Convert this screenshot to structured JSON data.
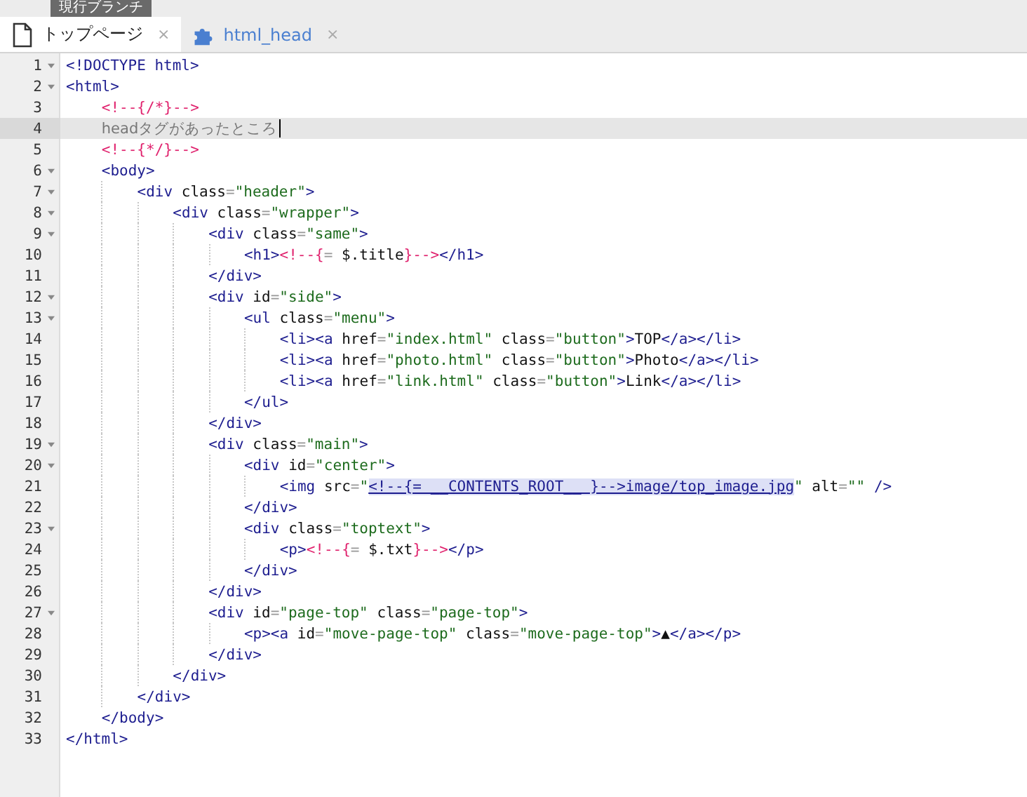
{
  "branch_label": "現行ブランチ",
  "tabs": [
    {
      "label": "トップページ",
      "selected": true,
      "close": "×"
    },
    {
      "label": "html_head",
      "selected": false,
      "close": "×"
    }
  ],
  "editor": {
    "lines": [
      {
        "number": "1",
        "foldable": true,
        "current": false,
        "tokens": [
          {
            "kind": "tag",
            "text": "<!DOCTYPE html>"
          }
        ]
      },
      {
        "number": "2",
        "foldable": true,
        "current": false,
        "tokens": [
          {
            "kind": "tag",
            "text": "<html>"
          }
        ],
        "children": [
          {
            "number": "3",
            "foldable": false,
            "current": false,
            "tokens": [
              {
                "kind": "tpl",
                "text": "<!--{/*}-->"
              }
            ]
          },
          {
            "number": "4",
            "foldable": false,
            "current": true,
            "tokens": [
              {
                "kind": "text",
                "text": "headタグがあったところ"
              }
            ]
          },
          {
            "number": "5",
            "foldable": false,
            "current": false,
            "tokens": [
              {
                "kind": "tpl",
                "text": "<!--{*/}-->"
              }
            ]
          },
          {
            "number": "6",
            "foldable": true,
            "current": false,
            "tokens": [
              {
                "kind": "tag",
                "text": "<body>"
              }
            ],
            "children": [
              {
                "number": "7",
                "foldable": true,
                "current": false,
                "tokens": [
                  {
                    "kind": "tag",
                    "text": "<div "
                  },
                  {
                    "kind": "attr",
                    "text": "class"
                  },
                  {
                    "kind": "op",
                    "text": "="
                  },
                  {
                    "kind": "str",
                    "text": "\"header\""
                  },
                  {
                    "kind": "tag",
                    "text": ">"
                  }
                ],
                "children": [
                  {
                    "number": "8",
                    "foldable": true,
                    "current": false,
                    "tokens": [
                      {
                        "kind": "tag",
                        "text": "<div "
                      },
                      {
                        "kind": "attr",
                        "text": "class"
                      },
                      {
                        "kind": "op",
                        "text": "="
                      },
                      {
                        "kind": "str",
                        "text": "\"wrapper\""
                      },
                      {
                        "kind": "tag",
                        "text": ">"
                      }
                    ],
                    "children": [
                      {
                        "number": "9",
                        "foldable": true,
                        "current": false,
                        "tokens": [
                          {
                            "kind": "tag",
                            "text": "<div "
                          },
                          {
                            "kind": "attr",
                            "text": "class"
                          },
                          {
                            "kind": "op",
                            "text": "="
                          },
                          {
                            "kind": "str",
                            "text": "\"same\""
                          },
                          {
                            "kind": "tag",
                            "text": ">"
                          }
                        ],
                        "children": [
                          {
                            "number": "10",
                            "foldable": false,
                            "current": false,
                            "tokens": [
                              {
                                "kind": "tag",
                                "text": "<h1>"
                              },
                              {
                                "kind": "tpl",
                                "text": "<!--{"
                              },
                              {
                                "kind": "op",
                                "text": "="
                              },
                              {
                                "kind": "attr",
                                "text": " $.title"
                              },
                              {
                                "kind": "tpl",
                                "text": "}-->"
                              },
                              {
                                "kind": "tag",
                                "text": "</h1>"
                              }
                            ]
                          }
                        ]
                      },
                      {
                        "number": "11",
                        "foldable": false,
                        "current": false,
                        "tokens": [
                          {
                            "kind": "tag",
                            "text": "</div>"
                          }
                        ]
                      },
                      {
                        "number": "12",
                        "foldable": true,
                        "current": false,
                        "tokens": [
                          {
                            "kind": "tag",
                            "text": "<div "
                          },
                          {
                            "kind": "attr",
                            "text": "id"
                          },
                          {
                            "kind": "op",
                            "text": "="
                          },
                          {
                            "kind": "str",
                            "text": "\"side\""
                          },
                          {
                            "kind": "tag",
                            "text": ">"
                          }
                        ],
                        "children": [
                          {
                            "number": "13",
                            "foldable": true,
                            "current": false,
                            "tokens": [
                              {
                                "kind": "tag",
                                "text": "<ul "
                              },
                              {
                                "kind": "attr",
                                "text": "class"
                              },
                              {
                                "kind": "op",
                                "text": "="
                              },
                              {
                                "kind": "str",
                                "text": "\"menu\""
                              },
                              {
                                "kind": "tag",
                                "text": ">"
                              }
                            ],
                            "children": [
                              {
                                "number": "14",
                                "foldable": false,
                                "current": false,
                                "tokens": [
                                  {
                                    "kind": "tag",
                                    "text": "<li><a "
                                  },
                                  {
                                    "kind": "attr",
                                    "text": "href"
                                  },
                                  {
                                    "kind": "op",
                                    "text": "="
                                  },
                                  {
                                    "kind": "str",
                                    "text": "\"index.html\""
                                  },
                                  {
                                    "kind": "attr",
                                    "text": " class"
                                  },
                                  {
                                    "kind": "op",
                                    "text": "="
                                  },
                                  {
                                    "kind": "str",
                                    "text": "\"button\""
                                  },
                                  {
                                    "kind": "tag",
                                    "text": ">"
                                  },
                                  {
                                    "kind": "attr",
                                    "text": "TOP"
                                  },
                                  {
                                    "kind": "tag",
                                    "text": "</a></li>"
                                  }
                                ]
                              },
                              {
                                "number": "15",
                                "foldable": false,
                                "current": false,
                                "tokens": [
                                  {
                                    "kind": "tag",
                                    "text": "<li><a "
                                  },
                                  {
                                    "kind": "attr",
                                    "text": "href"
                                  },
                                  {
                                    "kind": "op",
                                    "text": "="
                                  },
                                  {
                                    "kind": "str",
                                    "text": "\"photo.html\""
                                  },
                                  {
                                    "kind": "attr",
                                    "text": " class"
                                  },
                                  {
                                    "kind": "op",
                                    "text": "="
                                  },
                                  {
                                    "kind": "str",
                                    "text": "\"button\""
                                  },
                                  {
                                    "kind": "tag",
                                    "text": ">"
                                  },
                                  {
                                    "kind": "attr",
                                    "text": "Photo"
                                  },
                                  {
                                    "kind": "tag",
                                    "text": "</a></li>"
                                  }
                                ]
                              },
                              {
                                "number": "16",
                                "foldable": false,
                                "current": false,
                                "tokens": [
                                  {
                                    "kind": "tag",
                                    "text": "<li><a "
                                  },
                                  {
                                    "kind": "attr",
                                    "text": "href"
                                  },
                                  {
                                    "kind": "op",
                                    "text": "="
                                  },
                                  {
                                    "kind": "str",
                                    "text": "\"link.html\""
                                  },
                                  {
                                    "kind": "attr",
                                    "text": " class"
                                  },
                                  {
                                    "kind": "op",
                                    "text": "="
                                  },
                                  {
                                    "kind": "str",
                                    "text": "\"button\""
                                  },
                                  {
                                    "kind": "tag",
                                    "text": ">"
                                  },
                                  {
                                    "kind": "attr",
                                    "text": "Link"
                                  },
                                  {
                                    "kind": "tag",
                                    "text": "</a></li>"
                                  }
                                ]
                              }
                            ]
                          },
                          {
                            "number": "17",
                            "foldable": false,
                            "current": false,
                            "tokens": [
                              {
                                "kind": "tag",
                                "text": "</ul>"
                              }
                            ]
                          }
                        ]
                      },
                      {
                        "number": "18",
                        "foldable": false,
                        "current": false,
                        "tokens": [
                          {
                            "kind": "tag",
                            "text": "</div>"
                          }
                        ]
                      },
                      {
                        "number": "19",
                        "foldable": true,
                        "current": false,
                        "tokens": [
                          {
                            "kind": "tag",
                            "text": "<div "
                          },
                          {
                            "kind": "attr",
                            "text": "class"
                          },
                          {
                            "kind": "op",
                            "text": "="
                          },
                          {
                            "kind": "str",
                            "text": "\"main\""
                          },
                          {
                            "kind": "tag",
                            "text": ">"
                          }
                        ],
                        "children": [
                          {
                            "number": "20",
                            "foldable": true,
                            "current": false,
                            "tokens": [
                              {
                                "kind": "tag",
                                "text": "<div "
                              },
                              {
                                "kind": "attr",
                                "text": "id"
                              },
                              {
                                "kind": "op",
                                "text": "="
                              },
                              {
                                "kind": "str",
                                "text": "\"center\""
                              },
                              {
                                "kind": "tag",
                                "text": ">"
                              }
                            ],
                            "children": [
                              {
                                "number": "21",
                                "foldable": false,
                                "current": false,
                                "tokens": [
                                  {
                                    "kind": "tag",
                                    "text": "<img "
                                  },
                                  {
                                    "kind": "attr",
                                    "text": "src"
                                  },
                                  {
                                    "kind": "op",
                                    "text": "="
                                  },
                                  {
                                    "kind": "str",
                                    "text": "\""
                                  },
                                  {
                                    "kind": "link",
                                    "text": "<!--{= __CONTENTS_ROOT__ }-->image/top_image.jpg"
                                  },
                                  {
                                    "kind": "str",
                                    "text": "\""
                                  },
                                  {
                                    "kind": "attr",
                                    "text": " alt"
                                  },
                                  {
                                    "kind": "op",
                                    "text": "="
                                  },
                                  {
                                    "kind": "str",
                                    "text": "\"\""
                                  },
                                  {
                                    "kind": "tag",
                                    "text": " />"
                                  }
                                ]
                              }
                            ]
                          },
                          {
                            "number": "22",
                            "foldable": false,
                            "current": false,
                            "tokens": [
                              {
                                "kind": "tag",
                                "text": "</div>"
                              }
                            ]
                          },
                          {
                            "number": "23",
                            "foldable": true,
                            "current": false,
                            "tokens": [
                              {
                                "kind": "tag",
                                "text": "<div "
                              },
                              {
                                "kind": "attr",
                                "text": "class"
                              },
                              {
                                "kind": "op",
                                "text": "="
                              },
                              {
                                "kind": "str",
                                "text": "\"toptext\""
                              },
                              {
                                "kind": "tag",
                                "text": ">"
                              }
                            ],
                            "children": [
                              {
                                "number": "24",
                                "foldable": false,
                                "current": false,
                                "tokens": [
                                  {
                                    "kind": "tag",
                                    "text": "<p>"
                                  },
                                  {
                                    "kind": "tpl",
                                    "text": "<!--{"
                                  },
                                  {
                                    "kind": "op",
                                    "text": "="
                                  },
                                  {
                                    "kind": "attr",
                                    "text": " $.txt"
                                  },
                                  {
                                    "kind": "tpl",
                                    "text": "}-->"
                                  },
                                  {
                                    "kind": "tag",
                                    "text": "</p>"
                                  }
                                ]
                              }
                            ]
                          },
                          {
                            "number": "25",
                            "foldable": false,
                            "current": false,
                            "tokens": [
                              {
                                "kind": "tag",
                                "text": "</div>"
                              }
                            ]
                          }
                        ]
                      },
                      {
                        "number": "26",
                        "foldable": false,
                        "current": false,
                        "tokens": [
                          {
                            "kind": "tag",
                            "text": "</div>"
                          }
                        ]
                      },
                      {
                        "number": "27",
                        "foldable": true,
                        "current": false,
                        "tokens": [
                          {
                            "kind": "tag",
                            "text": "<div "
                          },
                          {
                            "kind": "attr",
                            "text": "id"
                          },
                          {
                            "kind": "op",
                            "text": "="
                          },
                          {
                            "kind": "str",
                            "text": "\"page-top\""
                          },
                          {
                            "kind": "attr",
                            "text": " class"
                          },
                          {
                            "kind": "op",
                            "text": "="
                          },
                          {
                            "kind": "str",
                            "text": "\"page-top\""
                          },
                          {
                            "kind": "tag",
                            "text": ">"
                          }
                        ],
                        "children": [
                          {
                            "number": "28",
                            "foldable": false,
                            "current": false,
                            "tokens": [
                              {
                                "kind": "tag",
                                "text": "<p><a "
                              },
                              {
                                "kind": "attr",
                                "text": "id"
                              },
                              {
                                "kind": "op",
                                "text": "="
                              },
                              {
                                "kind": "str",
                                "text": "\"move-page-top\""
                              },
                              {
                                "kind": "attr",
                                "text": " class"
                              },
                              {
                                "kind": "op",
                                "text": "="
                              },
                              {
                                "kind": "str",
                                "text": "\"move-page-top\""
                              },
                              {
                                "kind": "tag",
                                "text": ">"
                              },
                              {
                                "kind": "attr",
                                "text": "▲"
                              },
                              {
                                "kind": "tag",
                                "text": "</a></p>"
                              }
                            ]
                          }
                        ]
                      },
                      {
                        "number": "29",
                        "foldable": false,
                        "current": false,
                        "tokens": [
                          {
                            "kind": "tag",
                            "text": "</div>"
                          }
                        ]
                      }
                    ]
                  },
                  {
                    "number": "30",
                    "foldable": false,
                    "current": false,
                    "tokens": [
                      {
                        "kind": "tag",
                        "text": "</div>"
                      }
                    ]
                  }
                ]
              },
              {
                "number": "31",
                "foldable": false,
                "current": false,
                "tokens": [
                  {
                    "kind": "tag",
                    "text": "</div>"
                  }
                ]
              }
            ]
          },
          {
            "number": "32",
            "foldable": false,
            "current": false,
            "tokens": [
              {
                "kind": "tag",
                "text": "</body>"
              }
            ]
          }
        ]
      },
      {
        "number": "33",
        "foldable": false,
        "current": false,
        "tokens": [
          {
            "kind": "tag",
            "text": "</html>"
          }
        ]
      }
    ]
  }
}
